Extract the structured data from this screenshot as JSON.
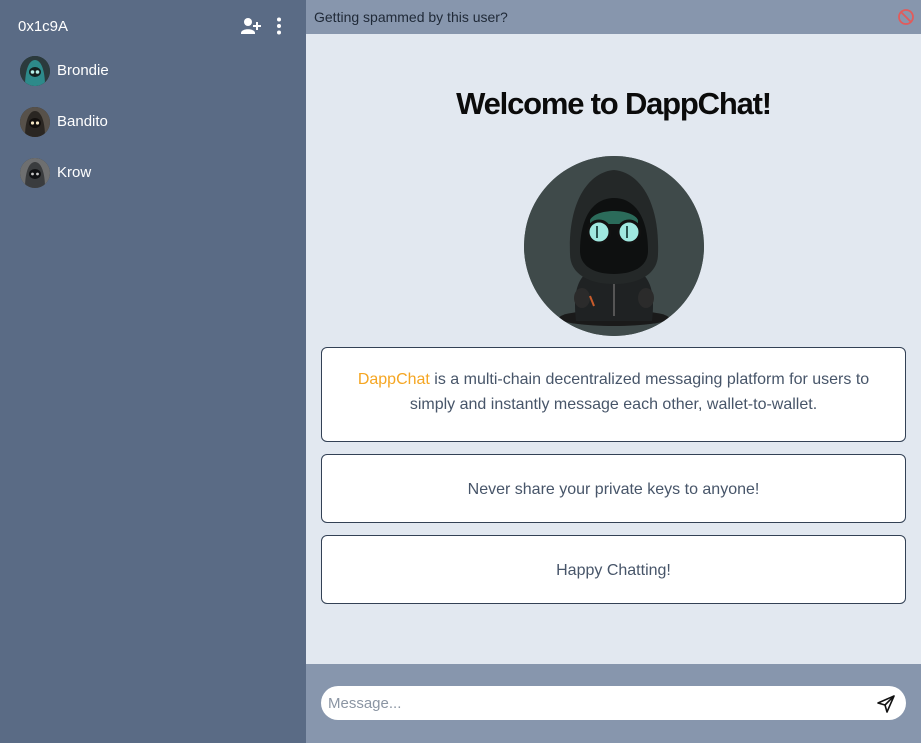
{
  "sidebar": {
    "account_id": "0x1c9A",
    "add_user_icon": "person-add-icon",
    "menu_icon": "more-vertical-icon",
    "contacts": [
      {
        "name": "Brondie",
        "avatar_color": "#2d8a8a"
      },
      {
        "name": "Bandito",
        "avatar_color": "#3a3530"
      },
      {
        "name": "Krow",
        "avatar_color": "#4a4d50"
      }
    ]
  },
  "topbar": {
    "spam_prompt": "Getting spammed by this user?",
    "block_icon": "block-icon",
    "block_color": "#e25b5b"
  },
  "main": {
    "welcome_title": "Welcome to DappChat!",
    "brand_name": "DappChat",
    "brand_color": "#f5a623",
    "intro_text": " is a multi-chain decentralized messaging platform for users to simply and instantly message each other, wallet-to-wallet.",
    "warning_text": "Never share your private keys to anyone!",
    "closing_text": "Happy Chatting!"
  },
  "composer": {
    "placeholder": "Message...",
    "value": "",
    "send_icon": "send-icon"
  }
}
